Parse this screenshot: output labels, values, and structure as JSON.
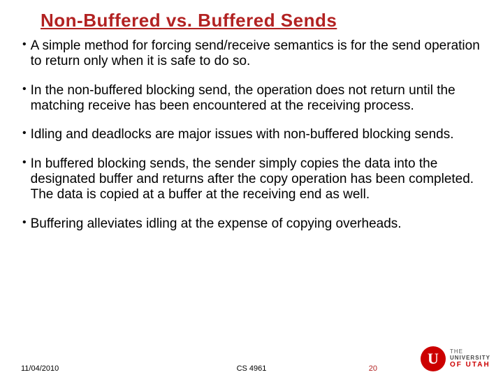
{
  "title": "Non-Buffered vs. Buffered Sends",
  "bullets": [
    "A simple method for forcing send/receive semantics is for the send operation to return only when it is safe to do so.",
    " In the non-buffered blocking send, the operation does not return until the matching receive has been encountered at the receiving process.",
    "Idling and deadlocks are major issues with non-buffered blocking sends.",
    "In buffered blocking sends, the sender simply copies the data into the designated buffer and returns after the copy operation has been completed. The data is copied at a buffer at the receiving end as well.",
    "Buffering alleviates idling at the expense of copying overheads."
  ],
  "footer": {
    "date": "11/04/2010",
    "course": "CS 4961",
    "page": "20"
  },
  "logo": {
    "line1": "THE",
    "line2": "UNIVERSITY",
    "line3": "OF UTAH"
  }
}
